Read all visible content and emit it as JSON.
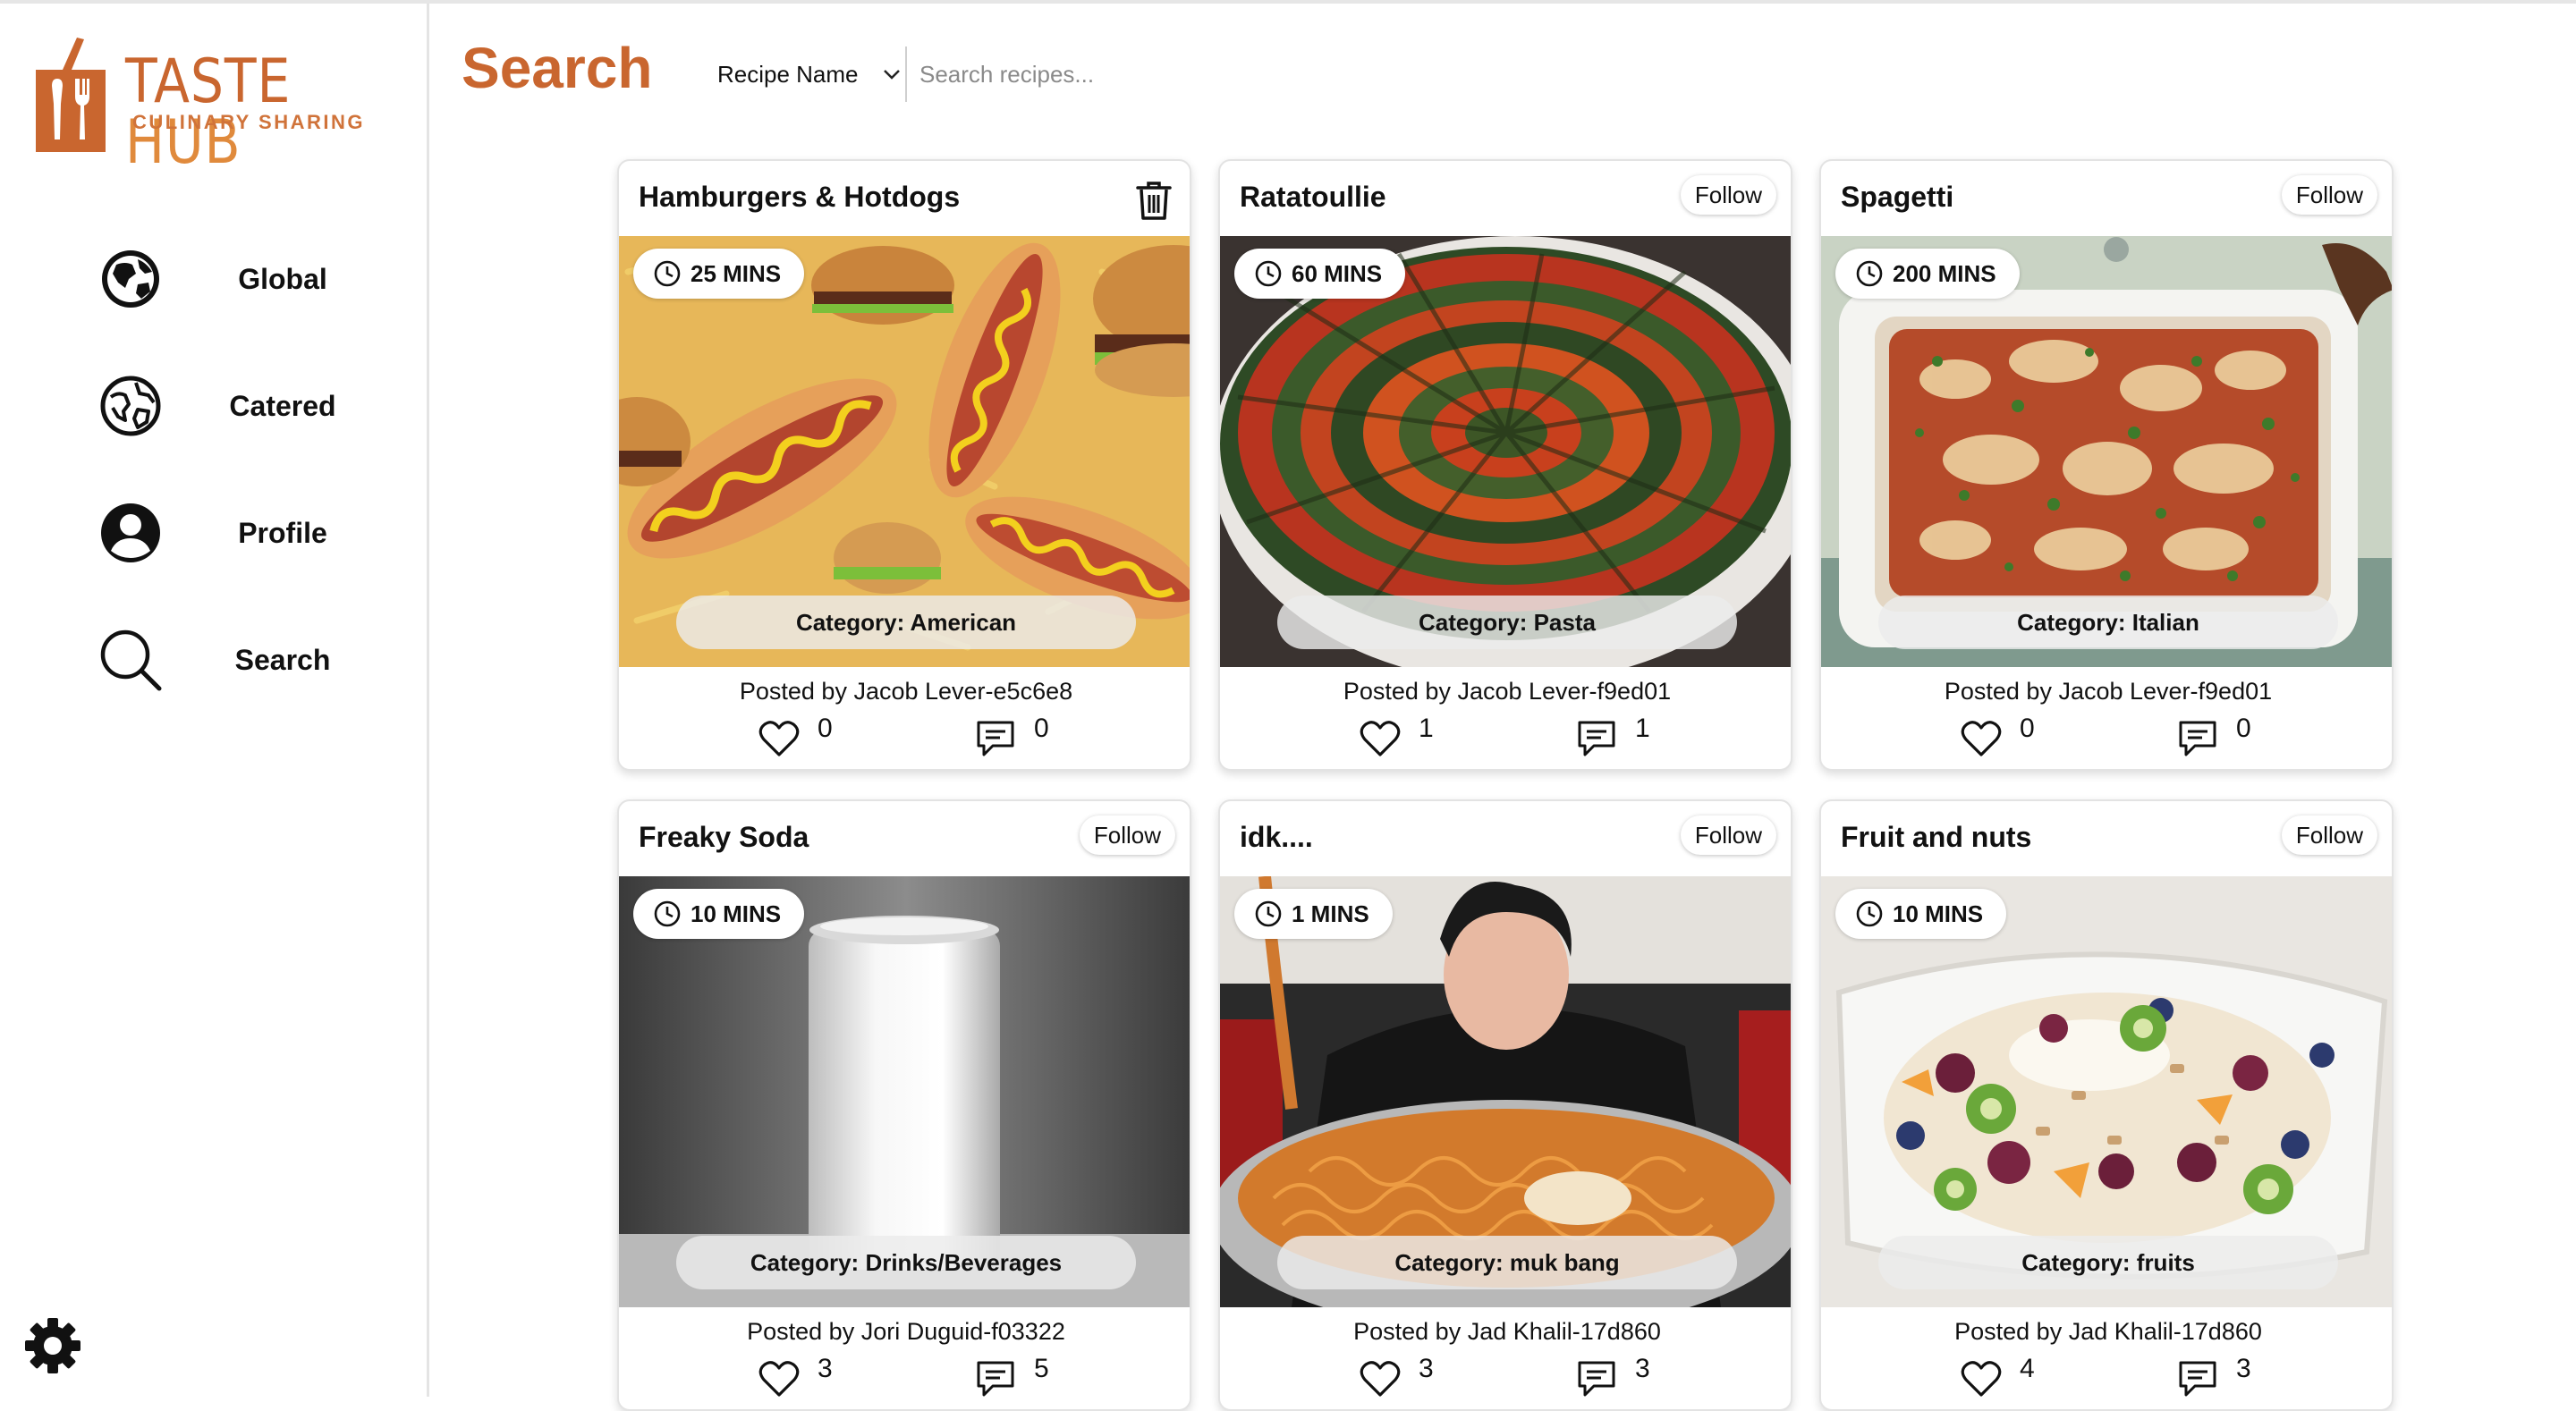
{
  "brand": {
    "title_part1": "TASTE ",
    "title_part2": "HUB",
    "subtitle": "CULINARY SHARING",
    "color_primary": "#c9662f",
    "color_secondary": "#e08a3c"
  },
  "sidebar": {
    "items": [
      {
        "label": "Global",
        "icon": "globe-filled-icon"
      },
      {
        "label": "Catered",
        "icon": "globe-outline-icon"
      },
      {
        "label": "Profile",
        "icon": "user-circle-icon"
      },
      {
        "label": "Search",
        "icon": "search-icon"
      }
    ],
    "settings_icon": "gear-icon"
  },
  "header": {
    "title": "Search",
    "filter": {
      "selected": "Recipe Name"
    },
    "search": {
      "placeholder": "Search recipes...",
      "value": ""
    }
  },
  "cards": [
    {
      "title": "Hamburgers & Hotdogs",
      "action": "delete",
      "time": "25 MINS",
      "category": "Category: American",
      "posted": "Posted by Jacob Lever-e5c6e8",
      "likes": "0",
      "comments": "0",
      "image": "hamburgers-hotdogs-photo"
    },
    {
      "title": "Ratatoullie",
      "action": "Follow",
      "time": "60 MINS",
      "category": "Category: Pasta",
      "posted": "Posted by Jacob Lever-f9ed01",
      "likes": "1",
      "comments": "1",
      "image": "ratatouille-photo"
    },
    {
      "title": "Spagetti",
      "action": "Follow",
      "time": "200 MINS",
      "category": "Category: Italian",
      "posted": "Posted by Jacob Lever-f9ed01",
      "likes": "0",
      "comments": "0",
      "image": "lasagna-dish-photo"
    },
    {
      "title": "Freaky Soda",
      "action": "Follow",
      "time": "10 MINS",
      "category": "Category: Drinks/Beverages",
      "posted": "Posted by Jori Duguid-f03322",
      "likes": "3",
      "comments": "5",
      "image": "white-soda-can-photo"
    },
    {
      "title": "idk....",
      "action": "Follow",
      "time": "1 MINS",
      "category": "Category: muk bang",
      "posted": "Posted by Jad Khalil-17d860",
      "likes": "3",
      "comments": "3",
      "image": "noodle-mukbang-photo"
    },
    {
      "title": "Fruit and nuts",
      "action": "Follow",
      "time": "10 MINS",
      "category": "Category: fruits",
      "posted": "Posted by Jad Khalil-17d860",
      "likes": "4",
      "comments": "3",
      "image": "fruit-salad-photo"
    }
  ]
}
